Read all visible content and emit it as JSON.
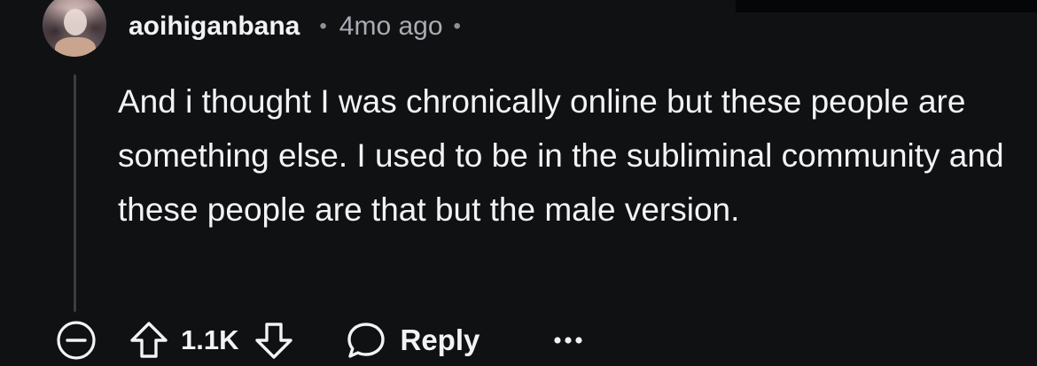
{
  "comment": {
    "author": "aoihiganbana",
    "separator": "•",
    "time": "4mo ago",
    "body": "And i thought I was chronically online but these people are something else. I used to be in the subliminal community and these people are that but the male version.",
    "score": "1.1K",
    "reply_label": "Reply"
  },
  "icons": {
    "collapse": "minus-circle-icon",
    "upvote": "arrow-up-outline-icon",
    "downvote": "arrow-down-outline-icon",
    "reply": "speech-bubble-icon",
    "more": "ellipsis-icon"
  },
  "colors": {
    "background": "#0f1113",
    "text": "#f2f3f5",
    "muted": "#a9adb2",
    "thread_line": "#3a3d42"
  }
}
